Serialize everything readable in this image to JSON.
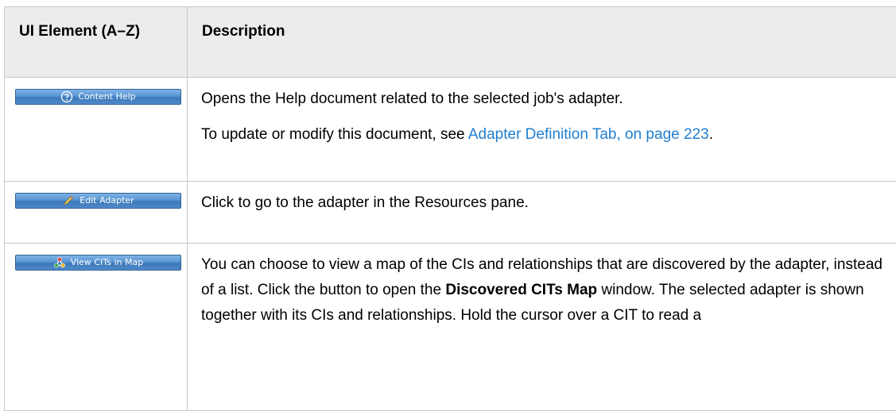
{
  "table": {
    "headers": {
      "element": "UI Element (A–Z)",
      "description": "Description"
    },
    "rows": [
      {
        "button": {
          "label": "Content Help",
          "icon": "help-icon"
        },
        "paragraphs": [
          {
            "text": "Opens the Help document related to the selected job's adapter."
          },
          {
            "prefix": "To update or modify this document, see ",
            "link": "Adapter Definition Tab, on page 223",
            "suffix": "."
          }
        ]
      },
      {
        "button": {
          "label": "Edit Adapter",
          "icon": "pencil-icon"
        },
        "paragraphs": [
          {
            "text": "Click to go to the adapter in the Resources pane."
          }
        ]
      },
      {
        "button": {
          "label": "View CITs in Map",
          "icon": "cit-map-icon"
        },
        "paragraphs": [
          {
            "text_before": "You can choose to view a map of the CIs and relationships that are discovered by the adapter, instead of a list. Click the button to open the ",
            "bold": "Discovered CITs Map",
            "text_after": " window. The selected adapter is shown together with its CIs and relationships. Hold the cursor over a CIT to read a"
          }
        ]
      }
    ]
  },
  "colors": {
    "header_background": "#ececec",
    "border": "#c8c8c8",
    "link": "#1f7fd1",
    "button_fill": "#5995d3"
  }
}
